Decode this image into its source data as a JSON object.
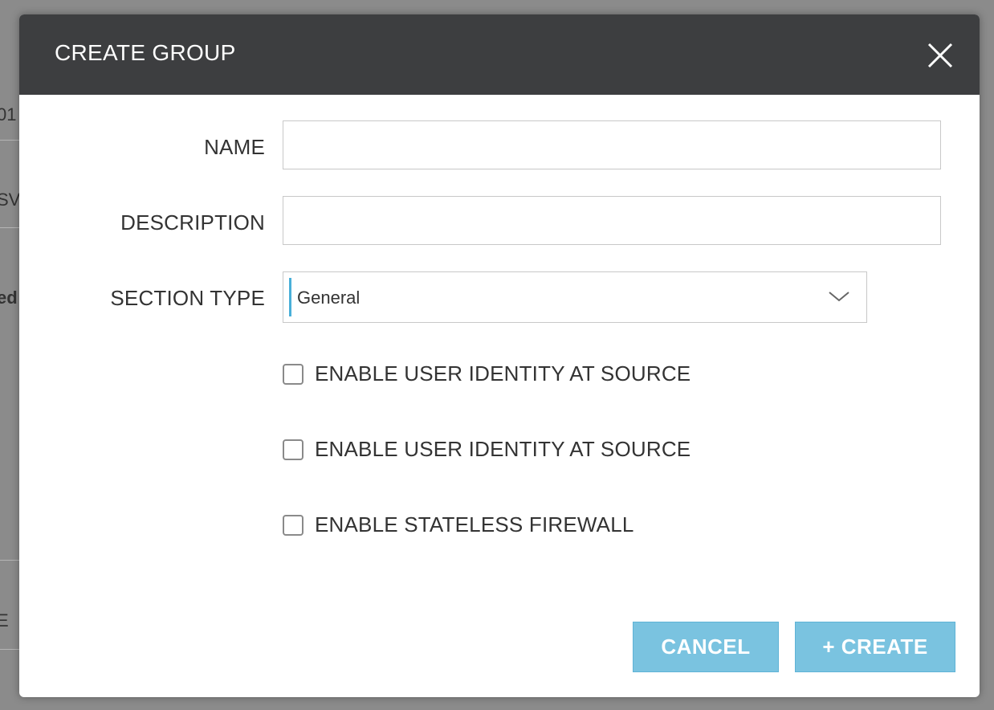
{
  "background": {
    "fragments": [
      "01",
      "SV",
      "ed",
      "E"
    ]
  },
  "dialog": {
    "title": "CREATE GROUP",
    "close_icon": "close-icon",
    "fields": {
      "name": {
        "label": "NAME",
        "value": "",
        "placeholder": ""
      },
      "description": {
        "label": "DESCRIPTION",
        "value": "",
        "placeholder": ""
      },
      "section_type": {
        "label": "SECTION TYPE",
        "selected": "General"
      }
    },
    "checkboxes": [
      {
        "label": "ENABLE USER IDENTITY AT SOURCE",
        "checked": false
      },
      {
        "label": "ENABLE USER IDENTITY AT SOURCE",
        "checked": false
      },
      {
        "label": "ENABLE STATELESS FIREWALL",
        "checked": false
      }
    ],
    "buttons": {
      "cancel": "CANCEL",
      "create": "+ CREATE"
    }
  },
  "colors": {
    "header_bg": "#3d3e40",
    "button_bg": "#7ac3e0",
    "select_accent": "#49afd9",
    "overlay": "#8b8b8b"
  }
}
